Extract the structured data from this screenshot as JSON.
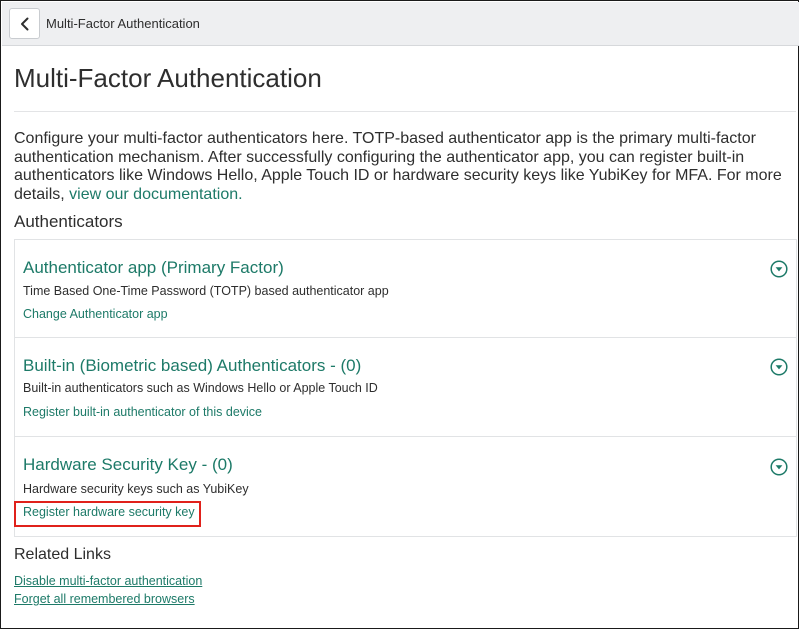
{
  "topbar": {
    "back_icon": "chevron-left-icon",
    "title": "Multi-Factor Authentication"
  },
  "page": {
    "title": "Multi-Factor Authentication",
    "intro_text": "Configure your multi-factor authenticators here. TOTP-based authenticator app is the primary multi-factor authentication mechanism. After successfully configuring the authenticator app, you can register built-in authenticators like Windows Hello, Apple Touch ID or hardware security keys like YubiKey for MFA. For more details, ",
    "intro_link": "view our documentation.",
    "authenticators_label": "Authenticators"
  },
  "authenticators": [
    {
      "title": "Authenticator app (Primary Factor)",
      "description": "Time Based One-Time Password (TOTP) based authenticator app",
      "action": "Change Authenticator app",
      "icon": "chevron-down-circle-icon"
    },
    {
      "title": "Built-in (Biometric based) Authenticators - (0)",
      "description": "Built-in authenticators such as Windows Hello or Apple Touch ID",
      "action": "Register built-in authenticator of this device",
      "icon": "chevron-down-circle-icon"
    },
    {
      "title": "Hardware Security Key - (0)",
      "description": "Hardware security keys such as YubiKey",
      "action": "Register hardware security key",
      "icon": "chevron-down-circle-icon"
    }
  ],
  "related": {
    "label": "Related Links",
    "links": [
      "Disable multi-factor authentication",
      "Forget all remembered browsers"
    ]
  },
  "colors": {
    "accent": "#1d7a68",
    "highlight": "#e0211b",
    "topbar_bg": "#eeeff1"
  }
}
